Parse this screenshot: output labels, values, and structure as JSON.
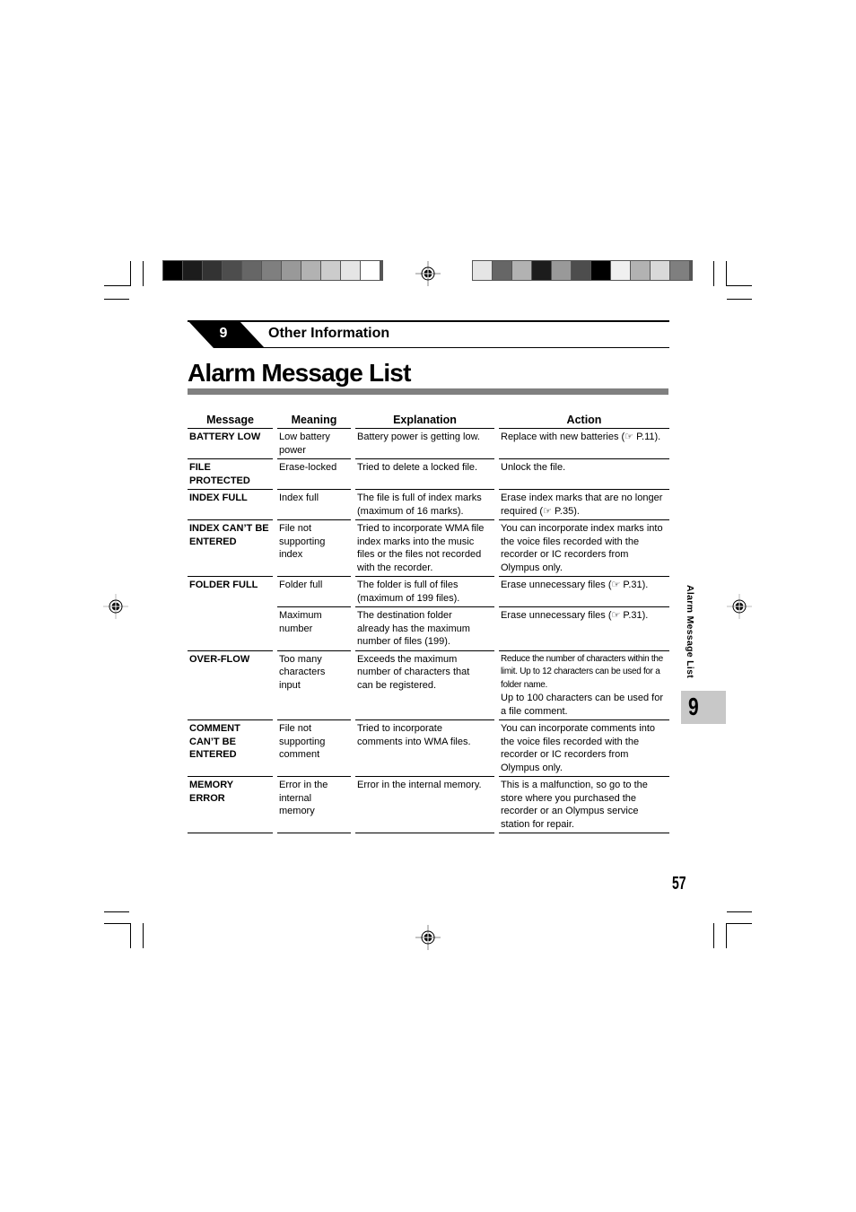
{
  "chapter": {
    "number": "9",
    "title": "Other Information"
  },
  "page_title": "Alarm Message List",
  "table": {
    "headers": [
      "Message",
      "Meaning",
      "Explanation",
      "Action"
    ],
    "rows": [
      {
        "message": "BATTERY LOW",
        "meaning": "Low battery power",
        "explanation": "Battery power is getting low.",
        "action": "Replace with new batteries (☞ P.11)."
      },
      {
        "message": "FILE PROTECTED",
        "meaning": "Erase-locked",
        "explanation": "Tried to delete a locked file.",
        "action": "Unlock the file."
      },
      {
        "message": "INDEX FULL",
        "meaning": "Index full",
        "explanation": "The file is full of index marks (maximum of 16 marks).",
        "action": "Erase index marks that are no longer required (☞ P.35)."
      },
      {
        "message": "INDEX CAN’T BE ENTERED",
        "meaning": "File not supporting index",
        "explanation": "Tried to incorporate WMA file index marks into the music files or the files not recorded with the recorder.",
        "action": "You can incorporate index marks into the voice files recorded with the recorder or IC recorders from Olympus only."
      },
      {
        "message": "FOLDER FULL",
        "meaning": "Folder full",
        "explanation": "The folder is full of files (maximum of 199 files).",
        "action": "Erase unnecessary files (☞ P.31)."
      },
      {
        "message": "",
        "meaning": "Maximum number",
        "explanation": "The destination folder already has the maximum number of files (199).",
        "action": "Erase unnecessary files (☞ P.31)."
      },
      {
        "message": "OVER-FLOW",
        "meaning": "Too many characters input",
        "explanation": "Exceeds the maximum number of characters that can be registered.",
        "action_small": "Reduce the number of characters within the limit. Up to 12 characters can be used for a folder name.",
        "action": "Up to 100 characters can be used for a file comment."
      },
      {
        "message": "COMMENT CAN’T BE ENTERED",
        "meaning": "File not supporting comment",
        "explanation": "Tried to incorporate comments into WMA files.",
        "action": "You can incorporate comments into the voice files recorded with the recorder or IC recorders from Olympus only."
      },
      {
        "message": "MEMORY ERROR",
        "meaning": "Error in the internal memory",
        "explanation": "Error in the internal memory.",
        "action": "This is a malfunction, so go to the store where you purchased the recorder or an Olympus service station for repair."
      }
    ]
  },
  "side_tab": {
    "label": "Alarm Message List",
    "number": "9"
  },
  "page_number": "57",
  "colorbar_left": [
    "#000000",
    "#1c1c1c",
    "#333333",
    "#4d4d4d",
    "#666666",
    "#7f7f7f",
    "#999999",
    "#b2b2b2",
    "#cccccc",
    "#e5e5e5",
    "#ffffff"
  ],
  "colorbar_right": [
    "#e5e5e5",
    "#666666",
    "#b2b2b2",
    "#1c1c1c",
    "#999999",
    "#4d4d4d",
    "#000000",
    "#f0f0f0",
    "#b2b2b2",
    "#d9d9d9",
    "#7f7f7f"
  ]
}
